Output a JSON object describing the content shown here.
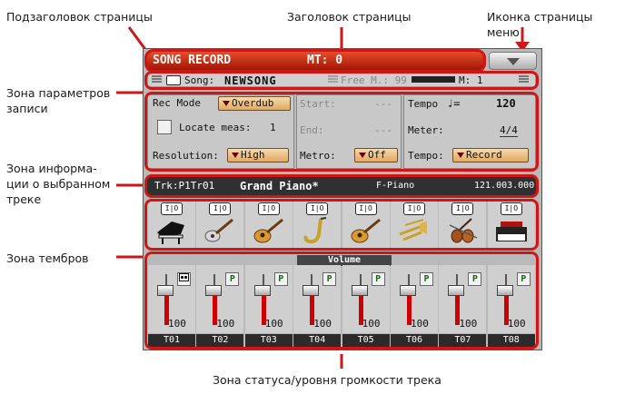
{
  "annotations": {
    "subtitle": "Подзаголовок страницы",
    "title": "Заголовок страницы",
    "menu_icon": "Иконка страницы меню",
    "params_line1": "Зона параметров",
    "params_line2": "записи",
    "trackinfo_line1": "Зона информа-",
    "trackinfo_line2": "ции о выбранном",
    "trackinfo_line3": "треке",
    "sounds": "Зона тембров",
    "volume": "Зона статуса/уровня громкости трека"
  },
  "header": {
    "mode": "SONG RECORD",
    "mt": "MT: 0"
  },
  "subbar": {
    "song_label": "Song:",
    "song_name": "NEWSONG",
    "free": "Free M.: 99",
    "measure": "M:  1"
  },
  "params": {
    "rec_mode_label": "Rec Mode",
    "rec_mode_value": "Overdub",
    "locate_label": "Locate meas:",
    "locate_value": "1",
    "resolution_label": "Resolution:",
    "resolution_value": "High",
    "start_label": "Start:",
    "start_value": "---",
    "end_label": "End:",
    "end_value": "---",
    "metro_label": "Metro:",
    "metro_value": "Off",
    "tempo_label": "Tempo",
    "tempo_note": "♩=",
    "tempo_value": "120",
    "meter_label": "Meter:",
    "meter_value": "4/4",
    "tempo_mode_label": "Tempo:",
    "tempo_mode_value": "Record"
  },
  "track": {
    "id": "Trk:P1Tr01",
    "sound": "Grand Piano*",
    "category": "F-Piano",
    "program": "121.003.000"
  },
  "sounds": [
    {
      "pill": "I|O",
      "icon": "grand-piano-icon"
    },
    {
      "pill": "I|O",
      "icon": "electric-guitar-icon"
    },
    {
      "pill": "I|O",
      "icon": "acoustic-guitar-icon"
    },
    {
      "pill": "I|O",
      "icon": "saxophone-icon"
    },
    {
      "pill": "I|O",
      "icon": "acoustic-guitar-icon"
    },
    {
      "pill": "I|O",
      "icon": "brass-icon"
    },
    {
      "pill": "I|O",
      "icon": "strings-icon"
    },
    {
      "pill": "I|O",
      "icon": "synth-keyboard-icon"
    }
  ],
  "mixer": {
    "volume_header": "Volume",
    "tracks": [
      {
        "label": "T01",
        "tag": "rec",
        "value": "100"
      },
      {
        "label": "T02",
        "tag": "P",
        "value": "100"
      },
      {
        "label": "T03",
        "tag": "P",
        "value": "100"
      },
      {
        "label": "T04",
        "tag": "P",
        "value": "100"
      },
      {
        "label": "T05",
        "tag": "P",
        "value": "100"
      },
      {
        "label": "T06",
        "tag": "P",
        "value": "100"
      },
      {
        "label": "T07",
        "tag": "P",
        "value": "100"
      },
      {
        "label": "T08",
        "tag": "P",
        "value": "100"
      }
    ]
  },
  "colors": {
    "accent": "#d01515",
    "title_bar": "#c2300f",
    "button": "#e8b56e"
  }
}
